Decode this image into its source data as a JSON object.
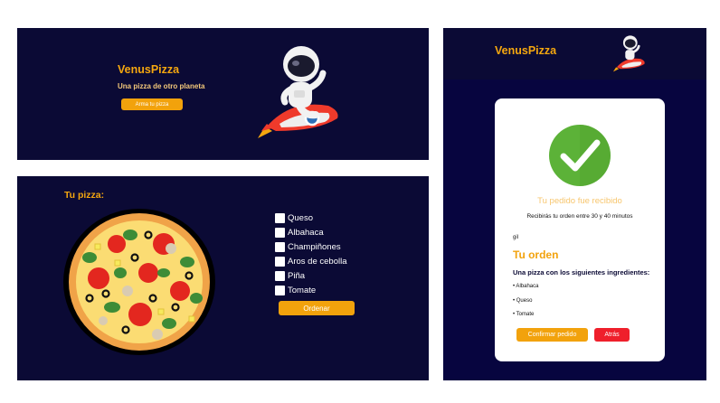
{
  "hero": {
    "brand": "VenusPizza",
    "tagline": "Una pizza de otro planeta",
    "cta_label": "Arma tu pizza"
  },
  "builder": {
    "title": "Tu pizza:",
    "ingredients": [
      "Queso",
      "Albahaca",
      "Champiñones",
      "Aros de cebolla",
      "Piña",
      "Tomate"
    ],
    "order_label": "Ordenar"
  },
  "confirmation": {
    "brand": "VenusPizza",
    "received_title": "Tu pedido fue recibido",
    "delivery_note": "Recibirás tu orden entre 30 y 40 minutos",
    "user_label": "gil",
    "order_title": "Tu orden",
    "order_intro": "Una pizza con los siguientes ingredientes:",
    "order_items": [
      "• Albahaca",
      "• Queso",
      "• Tomate"
    ],
    "confirm_label": "Confirmar pedido",
    "back_label": "Atrás"
  },
  "colors": {
    "panel_bg": "#0b0a35",
    "accent_orange": "#f2a20c",
    "danger_red": "#ef1f2b",
    "success_green": "#5cb238"
  },
  "icons": [
    "astronaut-on-rocket-icon",
    "pizza-illustration",
    "checkmark-icon"
  ]
}
